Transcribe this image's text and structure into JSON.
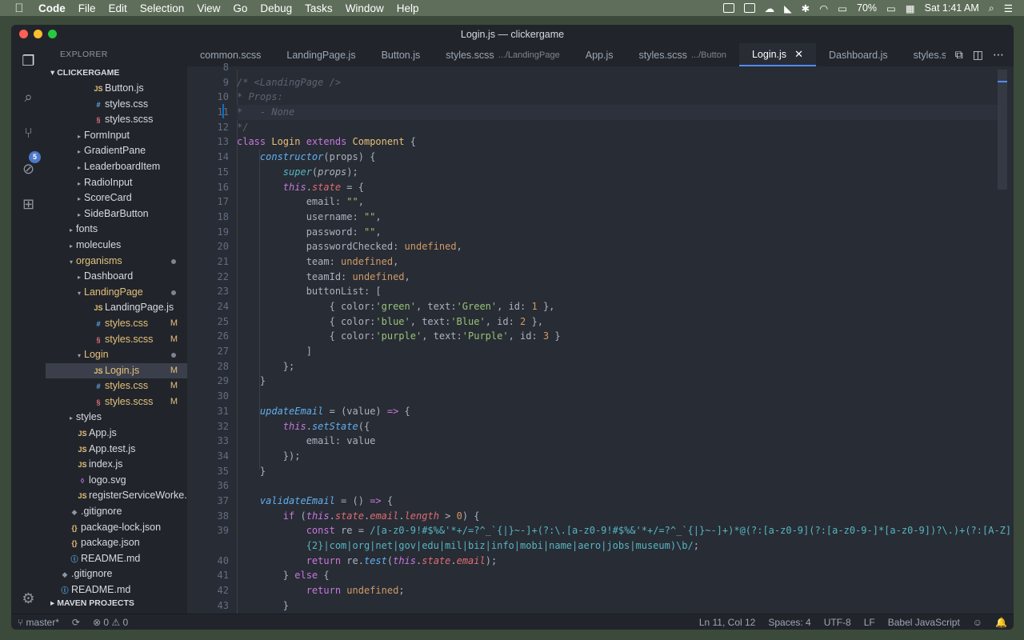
{
  "menubar": {
    "app": "Code",
    "items": [
      "File",
      "Edit",
      "Selection",
      "View",
      "Go",
      "Debug",
      "Tasks",
      "Window",
      "Help"
    ],
    "battery": "70%",
    "datetime": "Sat 1:41 AM"
  },
  "window": {
    "title": "Login.js — clickergame"
  },
  "explorer": {
    "header": "EXPLORER",
    "project": "CLICKERGAME",
    "footer_section": "MAVEN PROJECTS",
    "scm_badge": "5",
    "rows": [
      {
        "label": "Button.js",
        "type": "js",
        "icon": "JS",
        "indent": 4,
        "twisty": "",
        "status": ""
      },
      {
        "label": "styles.css",
        "type": "css",
        "icon": "#",
        "indent": 4,
        "twisty": "",
        "status": ""
      },
      {
        "label": "styles.scss",
        "type": "scss",
        "icon": "§",
        "indent": 4,
        "twisty": "",
        "status": ""
      },
      {
        "label": "FormInput",
        "type": "folder",
        "icon": "",
        "indent": 3,
        "twisty": "▸",
        "status": ""
      },
      {
        "label": "GradientPane",
        "type": "folder",
        "icon": "",
        "indent": 3,
        "twisty": "▸",
        "status": ""
      },
      {
        "label": "LeaderboardItem",
        "type": "folder",
        "icon": "",
        "indent": 3,
        "twisty": "▸",
        "status": ""
      },
      {
        "label": "RadioInput",
        "type": "folder",
        "icon": "",
        "indent": 3,
        "twisty": "▸",
        "status": ""
      },
      {
        "label": "ScoreCard",
        "type": "folder",
        "icon": "",
        "indent": 3,
        "twisty": "▸",
        "status": ""
      },
      {
        "label": "SideBarButton",
        "type": "folder",
        "icon": "",
        "indent": 3,
        "twisty": "▸",
        "status": ""
      },
      {
        "label": "fonts",
        "type": "folder",
        "icon": "",
        "indent": 2,
        "twisty": "▸",
        "status": ""
      },
      {
        "label": "molecules",
        "type": "folder",
        "icon": "",
        "indent": 2,
        "twisty": "▸",
        "status": ""
      },
      {
        "label": "organisms",
        "type": "folder-mod",
        "icon": "",
        "indent": 2,
        "twisty": "▾",
        "status": "dot"
      },
      {
        "label": "Dashboard",
        "type": "folder",
        "icon": "",
        "indent": 3,
        "twisty": "▸",
        "status": ""
      },
      {
        "label": "LandingPage",
        "type": "folder-mod",
        "icon": "",
        "indent": 3,
        "twisty": "▾",
        "status": "dot"
      },
      {
        "label": "LandingPage.js",
        "type": "js",
        "icon": "JS",
        "indent": 4,
        "twisty": "",
        "status": ""
      },
      {
        "label": "styles.css",
        "type": "css-mod",
        "icon": "#",
        "indent": 4,
        "twisty": "",
        "status": "M"
      },
      {
        "label": "styles.scss",
        "type": "scss-mod",
        "icon": "§",
        "indent": 4,
        "twisty": "",
        "status": "M"
      },
      {
        "label": "Login",
        "type": "folder-mod",
        "icon": "",
        "indent": 3,
        "twisty": "▾",
        "status": "dot"
      },
      {
        "label": "Login.js",
        "type": "js-mod",
        "icon": "JS",
        "indent": 4,
        "twisty": "",
        "status": "M",
        "selected": true
      },
      {
        "label": "styles.css",
        "type": "css-mod",
        "icon": "#",
        "indent": 4,
        "twisty": "",
        "status": "M"
      },
      {
        "label": "styles.scss",
        "type": "scss-mod",
        "icon": "§",
        "indent": 4,
        "twisty": "",
        "status": "M"
      },
      {
        "label": "styles",
        "type": "folder",
        "icon": "",
        "indent": 2,
        "twisty": "▸",
        "status": ""
      },
      {
        "label": "App.js",
        "type": "js",
        "icon": "JS",
        "indent": 2,
        "twisty": "",
        "status": ""
      },
      {
        "label": "App.test.js",
        "type": "js",
        "icon": "JS",
        "indent": 2,
        "twisty": "",
        "status": ""
      },
      {
        "label": "index.js",
        "type": "js",
        "icon": "JS",
        "indent": 2,
        "twisty": "",
        "status": ""
      },
      {
        "label": "logo.svg",
        "type": "svg",
        "icon": "◊",
        "indent": 2,
        "twisty": "",
        "status": ""
      },
      {
        "label": "registerServiceWorke..",
        "type": "js",
        "icon": "JS",
        "indent": 2,
        "twisty": "",
        "status": ""
      },
      {
        "label": ".gitignore",
        "type": "git",
        "icon": "◆",
        "indent": 1,
        "twisty": "",
        "status": ""
      },
      {
        "label": "package-lock.json",
        "type": "json",
        "icon": "{}",
        "indent": 1,
        "twisty": "",
        "status": ""
      },
      {
        "label": "package.json",
        "type": "json",
        "icon": "{}",
        "indent": 1,
        "twisty": "",
        "status": ""
      },
      {
        "label": "README.md",
        "type": "md",
        "icon": "ⓘ",
        "indent": 1,
        "twisty": "",
        "status": ""
      },
      {
        "label": ".gitignore",
        "type": "git",
        "icon": "◆",
        "indent": 0,
        "twisty": "",
        "status": ""
      },
      {
        "label": "README.md",
        "type": "md",
        "icon": "ⓘ",
        "indent": 0,
        "twisty": "",
        "status": ""
      }
    ]
  },
  "tabs": [
    {
      "label": "common.scss",
      "hint": ""
    },
    {
      "label": "LandingPage.js",
      "hint": ""
    },
    {
      "label": "Button.js",
      "hint": ""
    },
    {
      "label": "styles.scss",
      "hint": ".../LandingPage"
    },
    {
      "label": "App.js",
      "hint": ""
    },
    {
      "label": "styles.scss",
      "hint": ".../Button"
    },
    {
      "label": "Login.js",
      "hint": "",
      "active": true
    },
    {
      "label": "Dashboard.js",
      "hint": ""
    },
    {
      "label": "styles.s",
      "hint": ""
    }
  ],
  "editor": {
    "first_line": 8,
    "current_line": 11,
    "lines": [
      [
        [
          "",
          ""
        ]
      ],
      [
        [
          "c",
          "/* <LandingPage />"
        ]
      ],
      [
        [
          "c",
          "* Props:"
        ]
      ],
      [
        [
          "c",
          "*   - None"
        ]
      ],
      [
        [
          "c",
          "*/"
        ]
      ],
      [
        [
          "k",
          "class "
        ],
        [
          "cl-n",
          "Login "
        ],
        [
          "k",
          "extends "
        ],
        [
          "cl-n",
          "Component "
        ],
        [
          "p",
          "{"
        ]
      ],
      [
        [
          "t",
          "    "
        ],
        [
          "f it",
          "constructor"
        ],
        [
          "p",
          "("
        ],
        [
          "t",
          "props"
        ],
        [
          "p",
          ") {"
        ]
      ],
      [
        [
          "t",
          "        "
        ],
        [
          "o it",
          "super"
        ],
        [
          "p",
          "("
        ],
        [
          "t it",
          "props"
        ],
        [
          "p",
          ");"
        ]
      ],
      [
        [
          "t",
          "        "
        ],
        [
          "k it",
          "this"
        ],
        [
          "p",
          "."
        ],
        [
          "pr it",
          "state"
        ],
        [
          "t",
          " = {"
        ]
      ],
      [
        [
          "t",
          "            email: "
        ],
        [
          "s",
          "\"\""
        ],
        [
          "p",
          ","
        ]
      ],
      [
        [
          "t",
          "            username: "
        ],
        [
          "s",
          "\"\""
        ],
        [
          "p",
          ","
        ]
      ],
      [
        [
          "t",
          "            password: "
        ],
        [
          "s",
          "\"\""
        ],
        [
          "p",
          ","
        ]
      ],
      [
        [
          "t",
          "            passwordChecked: "
        ],
        [
          "n",
          "undefined"
        ],
        [
          "p",
          ","
        ]
      ],
      [
        [
          "t",
          "            team: "
        ],
        [
          "n",
          "undefined"
        ],
        [
          "p",
          ","
        ]
      ],
      [
        [
          "t",
          "            teamId: "
        ],
        [
          "n",
          "undefined"
        ],
        [
          "p",
          ","
        ]
      ],
      [
        [
          "t",
          "            buttonList: ["
        ]
      ],
      [
        [
          "t",
          "                { color:"
        ],
        [
          "s",
          "'green'"
        ],
        [
          "t",
          ", text:"
        ],
        [
          "s",
          "'Green'"
        ],
        [
          "t",
          ", id: "
        ],
        [
          "n",
          "1"
        ],
        [
          "t",
          " },"
        ]
      ],
      [
        [
          "t",
          "                { color:"
        ],
        [
          "s",
          "'blue'"
        ],
        [
          "t",
          ", text:"
        ],
        [
          "s",
          "'Blue'"
        ],
        [
          "t",
          ", id: "
        ],
        [
          "n",
          "2"
        ],
        [
          "t",
          " },"
        ]
      ],
      [
        [
          "t",
          "                { color:"
        ],
        [
          "s",
          "'purple'"
        ],
        [
          "t",
          ", text:"
        ],
        [
          "s",
          "'Purple'"
        ],
        [
          "t",
          ", id: "
        ],
        [
          "n",
          "3"
        ],
        [
          "t",
          " }"
        ]
      ],
      [
        [
          "t",
          "            ]"
        ]
      ],
      [
        [
          "t",
          "        };"
        ]
      ],
      [
        [
          "t",
          "    }"
        ]
      ],
      [
        [
          "",
          ""
        ]
      ],
      [
        [
          "t",
          "    "
        ],
        [
          "f it",
          "updateEmail"
        ],
        [
          "t",
          " = ("
        ],
        [
          "t",
          "value"
        ],
        [
          "t",
          ") "
        ],
        [
          "k",
          "=>"
        ],
        [
          "t",
          " {"
        ]
      ],
      [
        [
          "t",
          "        "
        ],
        [
          "k it",
          "this"
        ],
        [
          "p",
          "."
        ],
        [
          "f it",
          "setState"
        ],
        [
          "t",
          "({"
        ]
      ],
      [
        [
          "t",
          "            email: value"
        ]
      ],
      [
        [
          "t",
          "        });"
        ]
      ],
      [
        [
          "t",
          "    }"
        ]
      ],
      [
        [
          "",
          ""
        ]
      ],
      [
        [
          "t",
          "    "
        ],
        [
          "f it",
          "validateEmail"
        ],
        [
          "t",
          " = () "
        ],
        [
          "k",
          "=>"
        ],
        [
          "t",
          " {"
        ]
      ],
      [
        [
          "t",
          "        "
        ],
        [
          "k",
          "if "
        ],
        [
          "t",
          "("
        ],
        [
          "k it",
          "this"
        ],
        [
          "p",
          "."
        ],
        [
          "pr it",
          "state"
        ],
        [
          "p",
          "."
        ],
        [
          "pr it",
          "email"
        ],
        [
          "p",
          "."
        ],
        [
          "pr it",
          "length"
        ],
        [
          "t",
          " > "
        ],
        [
          "n",
          "0"
        ],
        [
          "t",
          ") {"
        ]
      ],
      [
        [
          "t",
          "            "
        ],
        [
          "k",
          "const "
        ],
        [
          "t",
          "re = "
        ],
        [
          "o",
          "/[a-z0-9!#$%&'*+/=?^_`{|}~-]+(?:\\.[a-z0-9!#$%&'*+/=?^_`{|}~-]+)*@(?:[a-z0-9](?:[a-z0-9-]*[a-z0-9])?\\.)+(?:[A-Z]"
        ]
      ],
      [
        [
          "o",
          "            {2}|com|org|net|gov|edu|mil|biz|info|mobi|name|aero|jobs|museum)\\b/"
        ],
        [
          "t",
          ";"
        ]
      ],
      [
        [
          "t",
          "            "
        ],
        [
          "k",
          "return "
        ],
        [
          "t",
          "re."
        ],
        [
          "f it",
          "test"
        ],
        [
          "t",
          "("
        ],
        [
          "k it",
          "this"
        ],
        [
          "p",
          "."
        ],
        [
          "pr it",
          "state"
        ],
        [
          "p",
          "."
        ],
        [
          "pr it",
          "email"
        ],
        [
          "t",
          ");"
        ]
      ],
      [
        [
          "t",
          "        } "
        ],
        [
          "k",
          "else "
        ],
        [
          "t",
          "{"
        ]
      ],
      [
        [
          "t",
          "            "
        ],
        [
          "k",
          "return "
        ],
        [
          "n",
          "undefined"
        ],
        [
          "t",
          ";"
        ]
      ],
      [
        [
          "t",
          "        }"
        ]
      ]
    ],
    "line_numbers": [
      "8",
      "9",
      "10",
      "11",
      "12",
      "13",
      "14",
      "15",
      "16",
      "17",
      "18",
      "19",
      "20",
      "21",
      "22",
      "23",
      "24",
      "25",
      "26",
      "27",
      "28",
      "29",
      "30",
      "31",
      "32",
      "33",
      "34",
      "35",
      "36",
      "37",
      "38",
      "39",
      "",
      "40",
      "41",
      "42",
      "43"
    ]
  },
  "statusbar": {
    "branch": "master*",
    "errors": "0",
    "warnings": "0",
    "position": "Ln 11, Col 12",
    "spaces": "Spaces: 4",
    "encoding": "UTF-8",
    "eol": "LF",
    "language": "Babel JavaScript"
  }
}
